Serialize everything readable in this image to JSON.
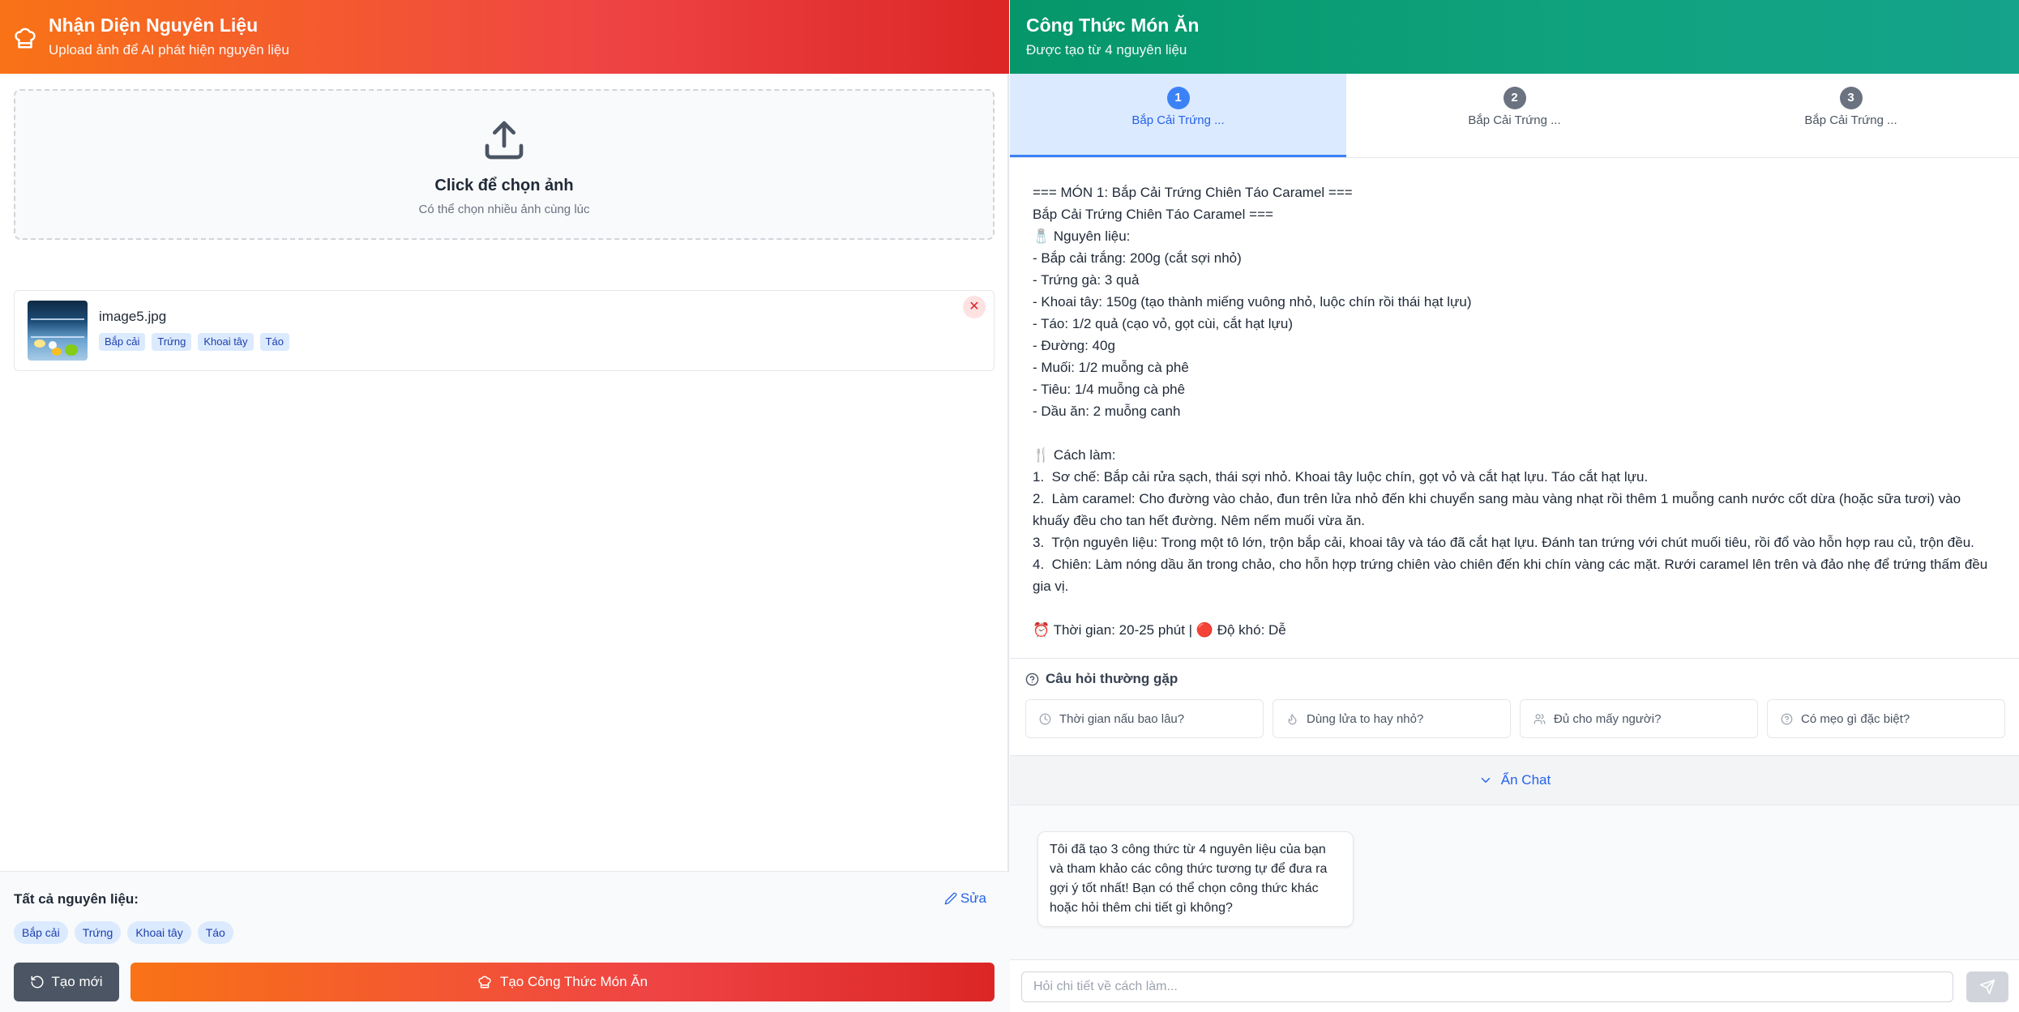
{
  "left": {
    "header": {
      "title": "Nhận Diện Nguyên Liệu",
      "subtitle": "Upload ảnh để AI phát hiện nguyên liệu"
    },
    "dropzone": {
      "title": "Click để chọn ảnh",
      "subtitle": "Có thể chọn nhiều ảnh cùng lúc"
    },
    "file": {
      "name": "image5.jpg",
      "tags": [
        "Bắp cải",
        "Trứng",
        "Khoai tây",
        "Táo"
      ],
      "remove": "✕"
    },
    "footer": {
      "all_label": "Tất cả nguyên liệu:",
      "edit_label": "Sửa",
      "ingredients": [
        "Bắp cải",
        "Trứng",
        "Khoai tây",
        "Táo"
      ],
      "new_button": "Tạo mới",
      "create_button": "Tạo Công Thức Món Ăn"
    }
  },
  "right": {
    "header": {
      "title": "Công Thức Món Ăn",
      "subtitle": "Được tạo từ 4 nguyên liệu"
    },
    "tabs": [
      {
        "num": "1",
        "label": "Bắp Cải Trứng ..."
      },
      {
        "num": "2",
        "label": "Bắp Cải Trứng ..."
      },
      {
        "num": "3",
        "label": "Bắp Cải Trứng ..."
      }
    ],
    "recipe_lines": [
      "=== MÓN 1: Bắp Cải Trứng Chiên Táo Caramel ===",
      "Bắp Cải Trứng Chiên Táo Caramel ===",
      "🧂 Nguyên liệu:",
      "- Bắp cải trắng: 200g (cắt sợi nhỏ)",
      "- Trứng gà: 3 quả",
      "- Khoai tây: 150g (tạo thành miếng vuông nhỏ, luộc chín rồi thái hạt lựu)",
      "- Táo: 1/2 quả (cạo vỏ, gọt cùi, cắt hạt lựu)",
      "- Đường: 40g",
      "- Muối: 1/2 muỗng cà phê",
      "- Tiêu: 1/4 muỗng cà phê",
      "- Dầu ăn: 2 muỗng canh",
      "",
      "🍴 Cách làm:",
      "1.  Sơ chế: Bắp cải rửa sạch, thái sợi nhỏ. Khoai tây luộc chín, gọt vỏ và cắt hạt lựu. Táo cắt hạt lựu.",
      "2.  Làm caramel: Cho đường vào chảo, đun trên lửa nhỏ đến khi chuyển sang màu vàng nhạt rồi thêm 1 muỗng canh nước cốt dừa (hoặc sữa tươi) vào khuấy đều cho tan hết đường. Nêm nếm muối vừa ăn.",
      "3.  Trộn nguyên liệu: Trong một tô lớn, trộn bắp cải, khoai tây và táo đã cắt hạt lựu. Đánh tan trứng với chút muối tiêu, rồi đổ vào hỗn hợp rau củ, trộn đều.",
      "4.  Chiên: Làm nóng dầu ăn trong chảo, cho hỗn hợp trứng chiên vào chiên đến khi chín vàng các mặt. Rưới caramel lên trên và đảo nhẹ để trứng thấm đều gia vị.",
      "",
      "⏰ Thời gian: 20-25 phút | 🔴 Độ khó: Dễ"
    ],
    "faq": {
      "title": "Câu hỏi thường gặp",
      "items": [
        "Thời gian nấu bao lâu?",
        "Dùng lửa to hay nhỏ?",
        "Đủ cho mấy người?",
        "Có mẹo gì đặc biệt?"
      ]
    },
    "hide_chat": "Ẩn Chat",
    "chat_message": "Tôi đã tạo 3 công thức từ 4 nguyên liệu của bạn và tham khảo các công thức tương tự để đưa ra gợi ý tốt nhất! Bạn có thể chọn công thức khác hoặc hỏi thêm chi tiết gì không?",
    "chat_input": {
      "placeholder": "Hỏi chi tiết về cách làm...",
      "value": ""
    }
  },
  "colors": {
    "left_header_gradient": [
      "#f97316",
      "#dc2626"
    ],
    "right_header_gradient": [
      "#059669",
      "#14a38b"
    ],
    "accent_blue": "#3b82f6",
    "tag_bg": "#dbeafe"
  }
}
